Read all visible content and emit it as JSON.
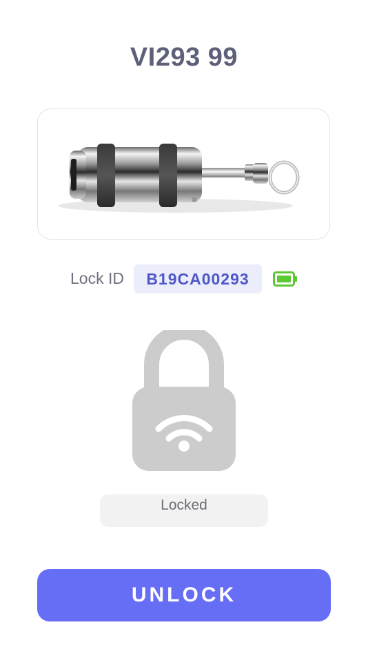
{
  "header": {
    "title": "VI293 99"
  },
  "device": {
    "image_icon": "cylinder-lock-keychain-image",
    "lock_id_label": "Lock ID",
    "lock_id_value": "B19CA00293",
    "battery_icon": "battery-full-icon",
    "battery_color": "#5cc832"
  },
  "lock": {
    "icon": "padlock-wifi-icon",
    "icon_color": "#cccccc",
    "status": "Locked"
  },
  "actions": {
    "unlock_label": "UNLOCK",
    "accent_color": "#676ef6"
  }
}
